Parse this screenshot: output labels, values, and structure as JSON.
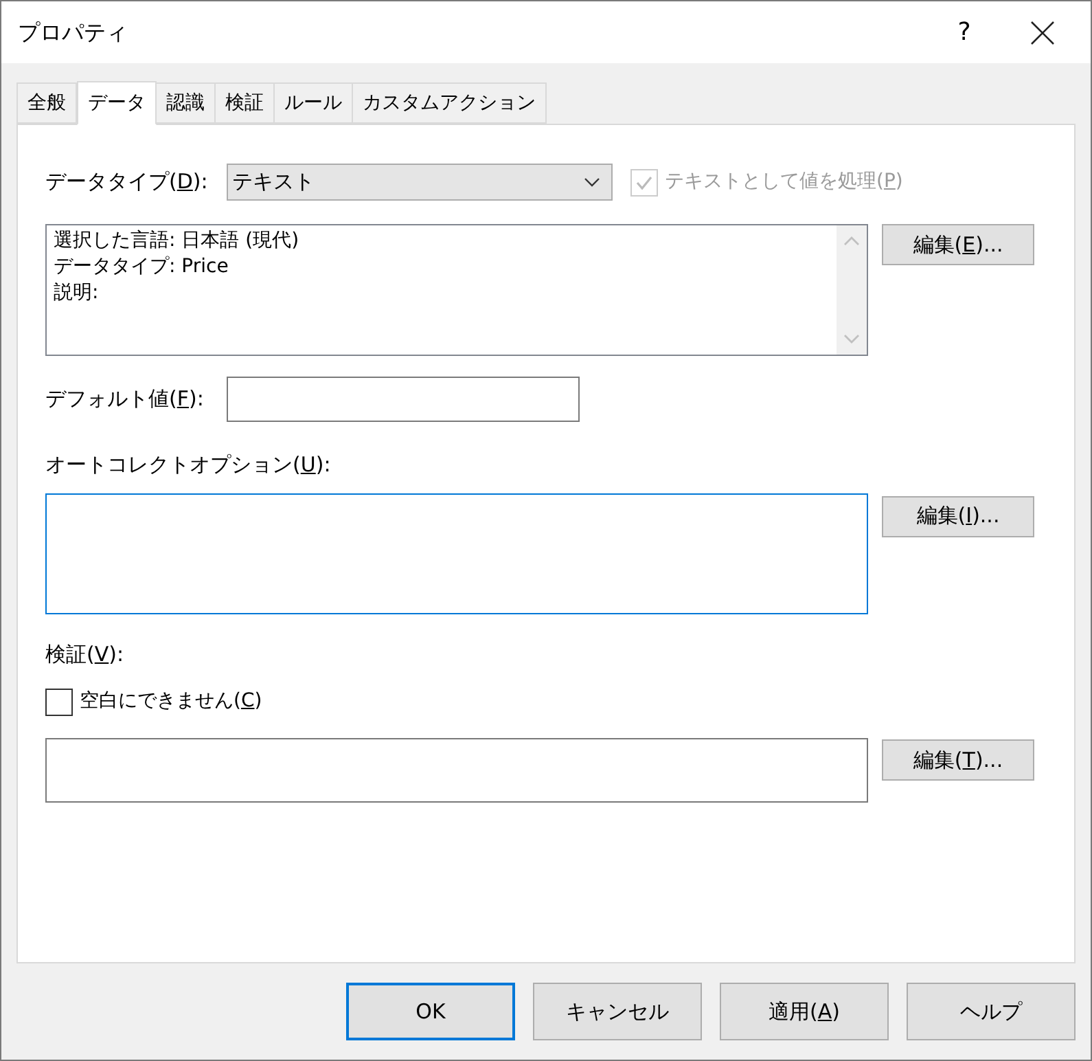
{
  "window": {
    "title": "プロパティ",
    "help": "?"
  },
  "tabs": [
    {
      "label": "全般",
      "selected": false
    },
    {
      "label": "データ",
      "selected": true
    },
    {
      "label": "認識",
      "selected": false
    },
    {
      "label": "検証",
      "selected": false
    },
    {
      "label": "ルール",
      "selected": false
    },
    {
      "label": "カスタムアクション",
      "selected": false
    }
  ],
  "data_type": {
    "label": {
      "before": "データタイプ(",
      "key": "D",
      "after": "):"
    },
    "value": "テキスト"
  },
  "treat_as_text": {
    "label": {
      "before": "テキストとして値を処理(",
      "key": "P",
      "after": ")"
    },
    "checked": true,
    "disabled": true
  },
  "info_box": {
    "lines": [
      "選択した言語: 日本語 (現代)",
      "データタイプ: Price",
      "説明:"
    ]
  },
  "info_edit": {
    "before": "編集(",
    "key": "E",
    "after": ")..."
  },
  "default_value": {
    "label": {
      "before": "デフォルト値(",
      "key": "F",
      "after": "):"
    }
  },
  "autocorrect": {
    "label": {
      "before": "オートコレクトオプション(",
      "key": "U",
      "after": "):"
    },
    "focused": true,
    "edit": {
      "before": "編集(",
      "key": "I",
      "after": ")..."
    }
  },
  "validation": {
    "label": {
      "before": "検証(",
      "key": "V",
      "after": "):"
    },
    "edit": {
      "before": "編集(",
      "key": "T",
      "after": ")..."
    }
  },
  "not_blank": {
    "label": {
      "before": "空白にできません(",
      "key": "C",
      "after": ")"
    },
    "checked": false,
    "disabled": false
  },
  "buttons": [
    {
      "label": {
        "before": "OK"
      },
      "default": true
    },
    {
      "label": {
        "before": "キャンセル"
      },
      "default": false
    },
    {
      "label": {
        "before": "適用(",
        "key": "A",
        "after": ")"
      },
      "default": false
    },
    {
      "label": {
        "before": "ヘルプ"
      },
      "default": false
    }
  ]
}
